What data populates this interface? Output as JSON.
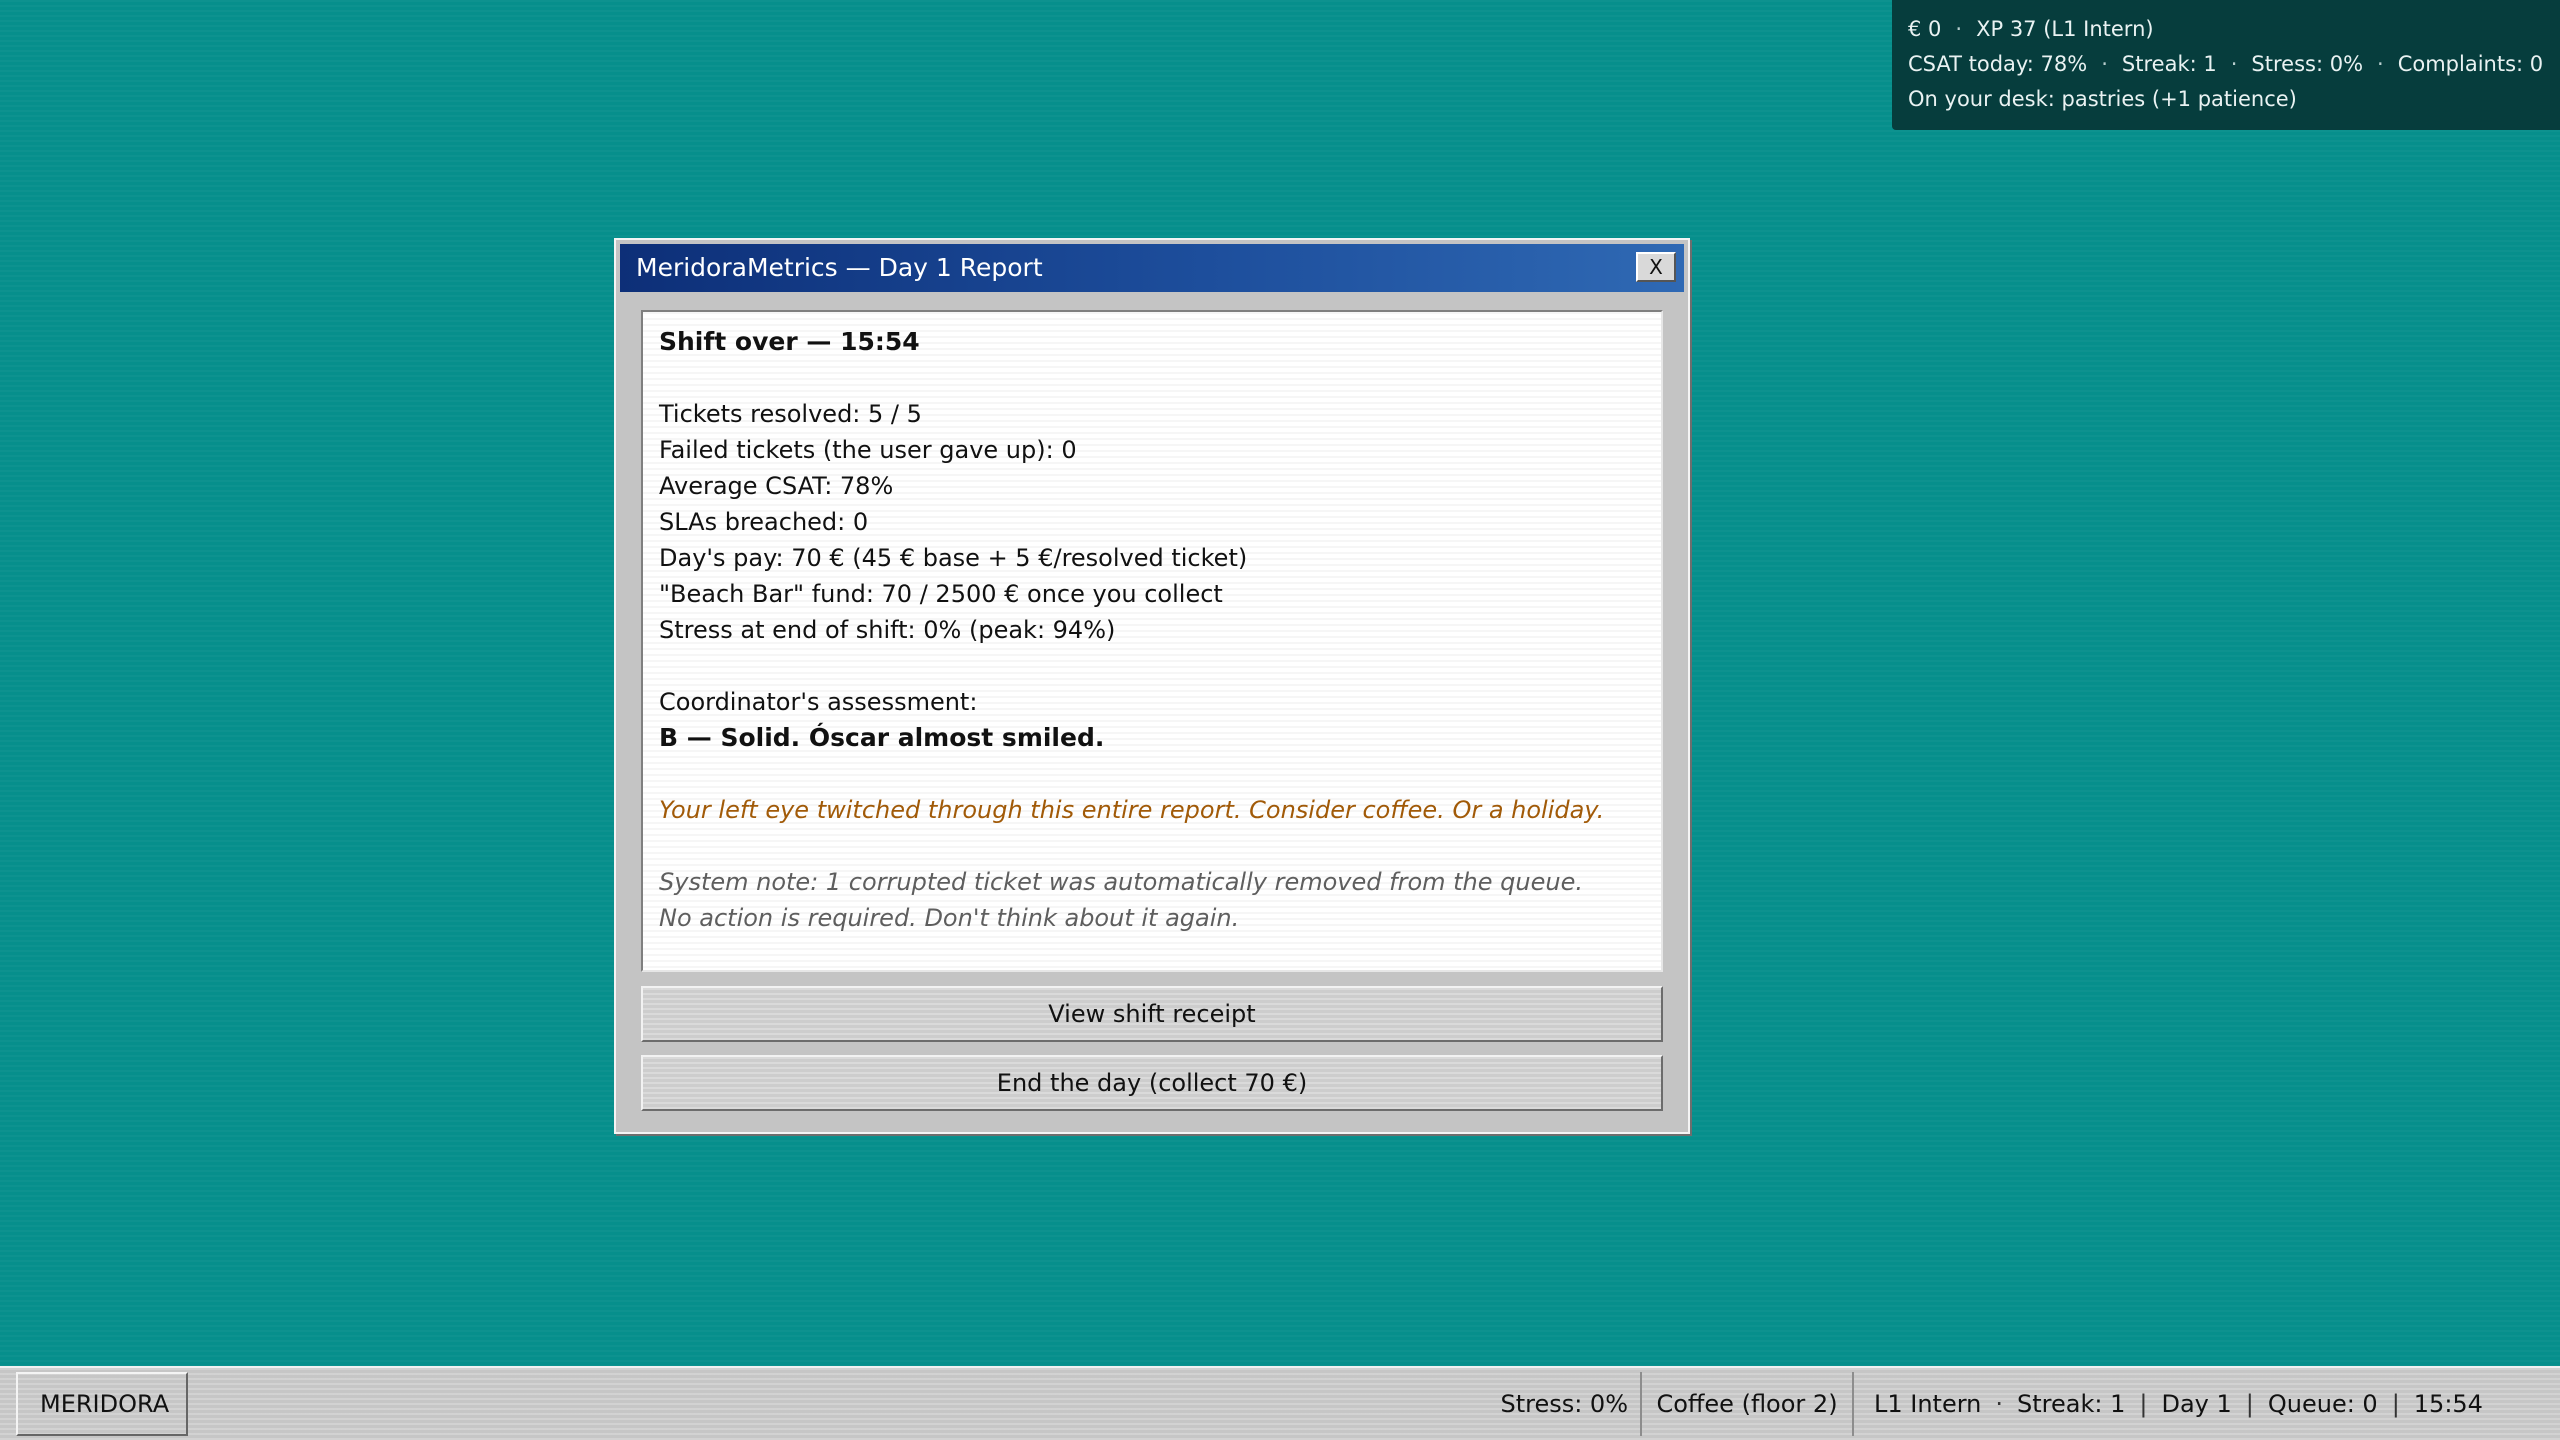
{
  "hud": {
    "money": "€ 0",
    "xp": "XP 37 (L1 Intern)",
    "csat": "CSAT today: 78%",
    "streak": "Streak: 1",
    "stress": "Stress: 0%",
    "complaints": "Complaints: 0",
    "desk": "On your desk: pastries (+1 patience)"
  },
  "dialog": {
    "title": "MeridoraMetrics — Day 1 Report",
    "close_label": "X",
    "heading": "Shift over — 15:54",
    "stats": [
      "Tickets resolved: 5 / 5",
      "Failed tickets (the user gave up): 0",
      "Average CSAT: 78%",
      "SLAs breached: 0",
      "Day's pay: 70 € (45 € base + 5 €/resolved ticket)",
      "\"Beach Bar\" fund: 70 / 2500 € once you collect",
      "Stress at end of shift: 0% (peak: 94%)"
    ],
    "assessment_label": "Coordinator's assessment:",
    "assessment_grade": "B — Solid. Óscar almost smiled.",
    "warning": "Your left eye twitched through this entire report. Consider coffee. Or a holiday.",
    "system_note_1": "System note: 1 corrupted ticket was automatically removed from the queue.",
    "system_note_2": "No action is required. Don't think about it again.",
    "receipt_button": "View shift receipt",
    "end_button": "End the day (collect 70 €)"
  },
  "taskbar": {
    "start_label": "MERIDORA",
    "stress": "Stress: 0%",
    "coffee": "Coffee (floor 2)",
    "rank": "L1 Intern",
    "streak": "Streak: 1",
    "day": "Day 1",
    "queue": "Queue: 0",
    "time": "15:54"
  },
  "colors": {
    "desktop": "#068f8c",
    "hud_bg": "#063d3d",
    "titlebar": "#1d4e9c",
    "warning_text": "#a15a08"
  }
}
